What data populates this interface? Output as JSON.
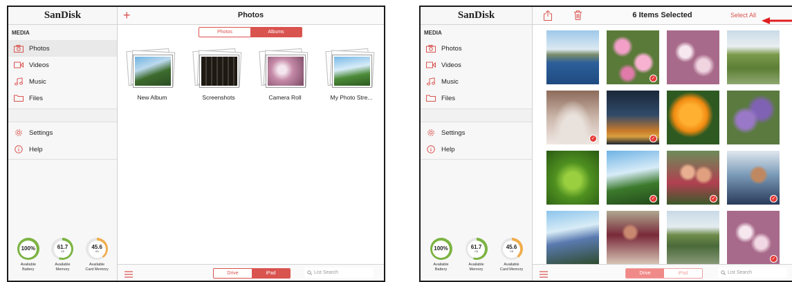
{
  "brand": "SanDisk",
  "sidebar": {
    "section": "MEDIA",
    "items": [
      {
        "label": "Photos",
        "icon": "camera-icon"
      },
      {
        "label": "Videos",
        "icon": "video-icon"
      },
      {
        "label": "Music",
        "icon": "music-note-icon"
      },
      {
        "label": "Files",
        "icon": "folder-icon"
      }
    ],
    "bottom_items": [
      {
        "label": "Settings",
        "icon": "gear-icon"
      },
      {
        "label": "Help",
        "icon": "info-icon"
      }
    ]
  },
  "gauges": [
    {
      "value": "100%",
      "unit": "",
      "label_1": "Available",
      "label_2": "Battery",
      "fraction": 1.0,
      "color": "#7cb342"
    },
    {
      "value": "61.7",
      "unit": "GB",
      "label_1": "Available",
      "label_2": "Memory",
      "fraction": 0.55,
      "color": "#7cb342"
    },
    {
      "value": "45.6",
      "unit": "GB",
      "label_1": "Available",
      "label_2": "Card Memory",
      "fraction": 0.4,
      "color": "#f0ad4e"
    }
  ],
  "left": {
    "title": "Photos",
    "plus": "+",
    "tabs": [
      "Photos",
      "Albums"
    ],
    "albums": [
      {
        "name": "New Album"
      },
      {
        "name": "Screenshots"
      },
      {
        "name": "Camera Roll"
      },
      {
        "name": "My Photo Stre..."
      }
    ]
  },
  "right": {
    "title": "6 Items Selected",
    "select_all": "Select All",
    "photos_selected": [
      false,
      true,
      false,
      false,
      true,
      true,
      false,
      false,
      false,
      true,
      true,
      true,
      false,
      false,
      false,
      true
    ]
  },
  "bottom": {
    "tabs": [
      "Drive",
      "iPad"
    ],
    "search_placeholder": "List Search"
  },
  "colors": {
    "accent": "#d9534f",
    "check": "#e53935"
  }
}
